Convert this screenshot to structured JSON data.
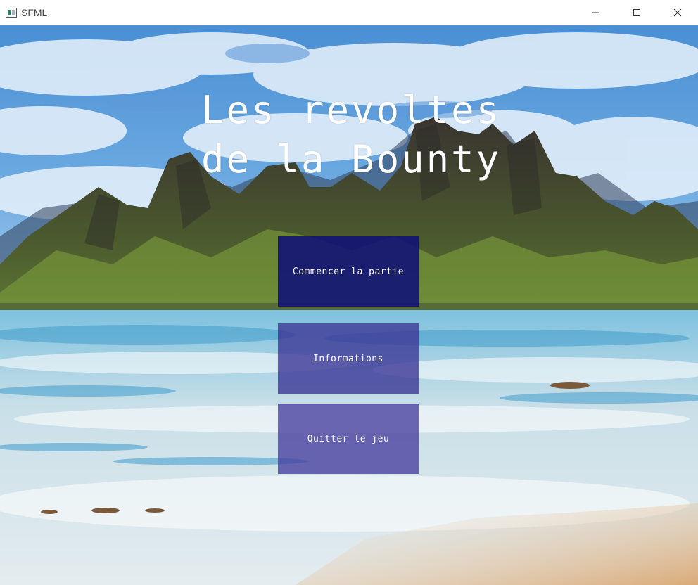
{
  "window": {
    "title": "SFML",
    "icon": "sfml-app-icon",
    "controls": [
      "minimize-icon",
      "maximize-icon",
      "close-icon"
    ]
  },
  "game": {
    "title_line1": "Les revoltes",
    "title_line2": "de la Bounty",
    "menu": {
      "start_label": "Commencer la partie",
      "info_label": "Informations",
      "quit_label": "Quitter le jeu"
    }
  },
  "colors": {
    "button_start": "#10107a",
    "button_other": "#463e9e",
    "title_text": "#ffffff"
  }
}
